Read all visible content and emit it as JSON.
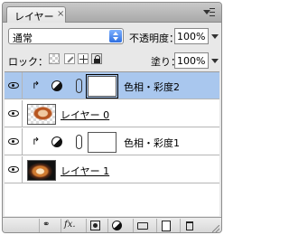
{
  "tab": {
    "label": "レイヤー",
    "close": "×"
  },
  "blend": {
    "mode": "通常"
  },
  "opacity": {
    "label": "不透明度：",
    "value": "100%"
  },
  "lock": {
    "label": "ロック："
  },
  "fill": {
    "label": "塗り：",
    "value": "100%"
  },
  "layers": [
    {
      "name": "色相・彩度2",
      "type": "adjustment",
      "clipped": true,
      "selected": true,
      "visible": true
    },
    {
      "name": "レイヤー 0",
      "type": "raster",
      "selected": false,
      "visible": true
    },
    {
      "name": "色相・彩度1",
      "type": "adjustment",
      "clipped": true,
      "selected": false,
      "visible": true
    },
    {
      "name": "レイヤー 1",
      "type": "raster",
      "selected": false,
      "visible": true
    }
  ],
  "toolbar": {
    "fx_label": "fx."
  },
  "colors": {
    "selected_row": "#a9c7ee",
    "select_arrow": "#2f6fe0"
  }
}
